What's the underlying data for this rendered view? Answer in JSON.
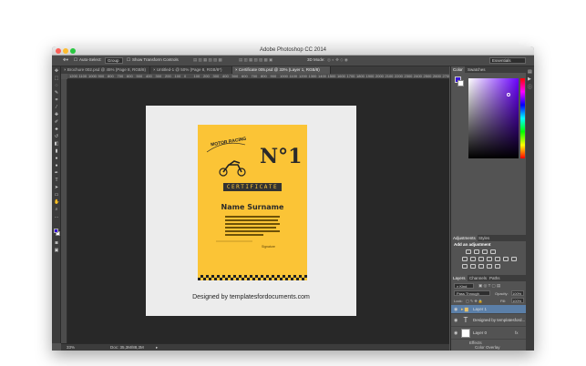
{
  "window": {
    "title": "Adobe Photoshop CC 2014"
  },
  "options_bar": {
    "auto_select_label": "Auto-Select:",
    "auto_select_value": "Group",
    "show_transform_label": "Show Transform Controls",
    "mode_3d": "3D Mode:",
    "workspace": "Essentials"
  },
  "tabs": [
    {
      "label": "Brochure 002.psd @ 45% (Page 8, RGB/8)"
    },
    {
      "label": "Untitled-1 @ 50% (Page 8, RGB/8*)"
    },
    {
      "label": "Certificate 005.psd @ 33% (Layer 1, RGB/8)"
    }
  ],
  "ruler": {
    "ticks": [
      "1200",
      "1100",
      "1000",
      "900",
      "800",
      "700",
      "600",
      "500",
      "400",
      "300",
      "200",
      "100",
      "0",
      "100",
      "200",
      "300",
      "400",
      "500",
      "600",
      "700",
      "800",
      "900",
      "1000",
      "1100",
      "1200",
      "1300",
      "1400",
      "1500",
      "1600",
      "1700",
      "1800",
      "1900",
      "2000",
      "2100",
      "2200",
      "2300",
      "2400",
      "2500",
      "2600",
      "2700",
      "2800"
    ]
  },
  "certificate": {
    "badge": "MOTOR RACING",
    "number": "N°1",
    "title": "CERTIFICATE",
    "name": "Name Surname",
    "signature": "Signature",
    "caption": "Designed by templatesfordocuments.com"
  },
  "status": {
    "zoom": "33%",
    "doc": "Doc: 35,3M/88,3M"
  },
  "panels": {
    "color_tabs": [
      "Color",
      "Swatches"
    ],
    "adjust_tabs": [
      "Adjustments",
      "Styles"
    ],
    "add_adjustment": "Add an adjustment",
    "layer_tabs": [
      "Layers",
      "Channels",
      "Paths"
    ],
    "kind": "Kind",
    "blend_mode": "Pass Through",
    "opacity_label": "Opacity:",
    "opacity_value": "100%",
    "lock_label": "Lock:",
    "fill_label": "Fill:",
    "fill_value": "100%",
    "layers": [
      {
        "name": "Layer 1",
        "type": "group"
      },
      {
        "name": "Designed by templatesford...",
        "type": "text"
      },
      {
        "name": "Layer 0",
        "type": "image",
        "fx": "fx"
      }
    ],
    "effects_label": "Effects",
    "color_overlay": "Color Overlay"
  },
  "colors": {
    "foreground": "#3a17d8",
    "background": "#ffffff",
    "certificate": "#fbc436",
    "selected_layer": "#5b7fa8"
  }
}
